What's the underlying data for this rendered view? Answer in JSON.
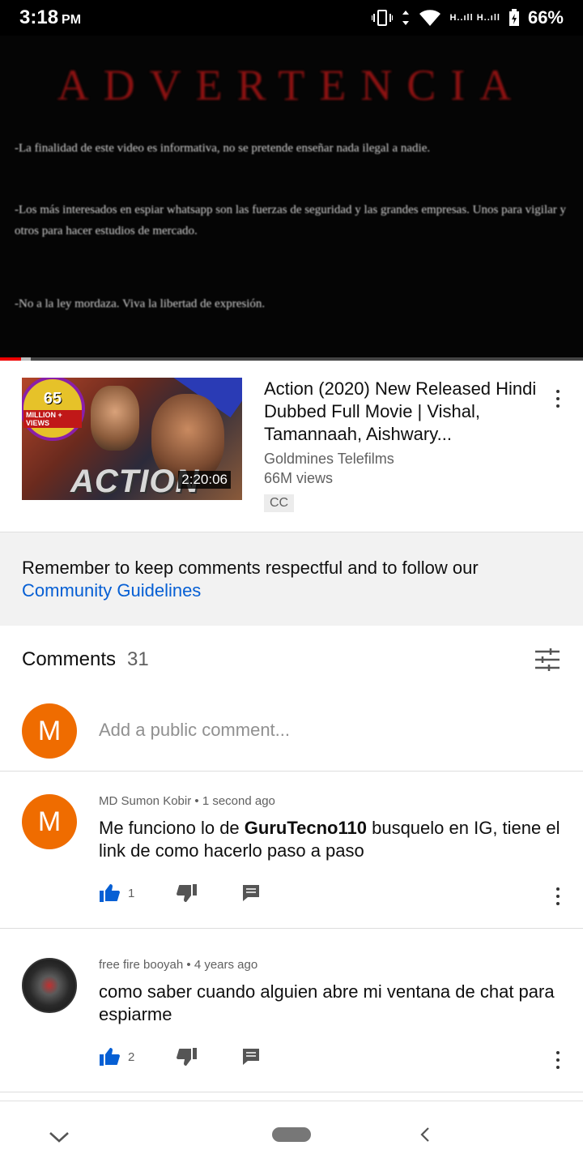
{
  "status_bar": {
    "time": "3:18",
    "ampm": "PM",
    "battery": "66%",
    "signal": "H..ıll H..ıll"
  },
  "player": {
    "title": "ADVERTENCIA",
    "lines": [
      "-La finalidad de este video es informativa, no se pretende enseñar nada  ilegal a nadie.",
      "-Los  más interesados en espiar whatsapp son las fuerzas de seguridad y las grandes empresas. Unos para vigilar y otros para hacer estudios de mercado.",
      "-No a la ley mordaza. Viva la libertad de expresión."
    ],
    "progress_played_fraction": 0.036
  },
  "suggested": {
    "title": "Action (2020) New Released Hindi Dubbed Full Movie | Vishal, Tamannaah, Aishwary...",
    "channel": "Goldmines Telefilms",
    "views": "66M views",
    "badge": "CC",
    "duration": "2:20:06",
    "thumb_badge_number": "65",
    "thumb_badge_text": "MILLION + VIEWS",
    "thumb_word": "ACTION"
  },
  "notice": {
    "text": "Remember to keep comments respectful and to follow our",
    "link": "Community Guidelines"
  },
  "comments": {
    "label": "Comments",
    "count": "31",
    "add_placeholder": "Add a public comment...",
    "user_initial": "M",
    "items": [
      {
        "author": "MD Sumon Kobir",
        "time": "1 second ago",
        "text_before": "Me funciono lo de ",
        "text_bold": "GuruTecno110",
        "text_after": " busquelo en IG, tiene el link de como hacerlo paso a paso",
        "likes": "1",
        "avatar_initial": "M"
      },
      {
        "author": "free fire booyah",
        "time": "4 years ago",
        "text": "como saber cuando alguien abre mi ventana de chat para espiarme",
        "likes": "2"
      }
    ]
  },
  "colors": {
    "accent_blue": "#065fd4",
    "avatar_orange": "#ef6c00",
    "progress_red": "#ee0000"
  }
}
